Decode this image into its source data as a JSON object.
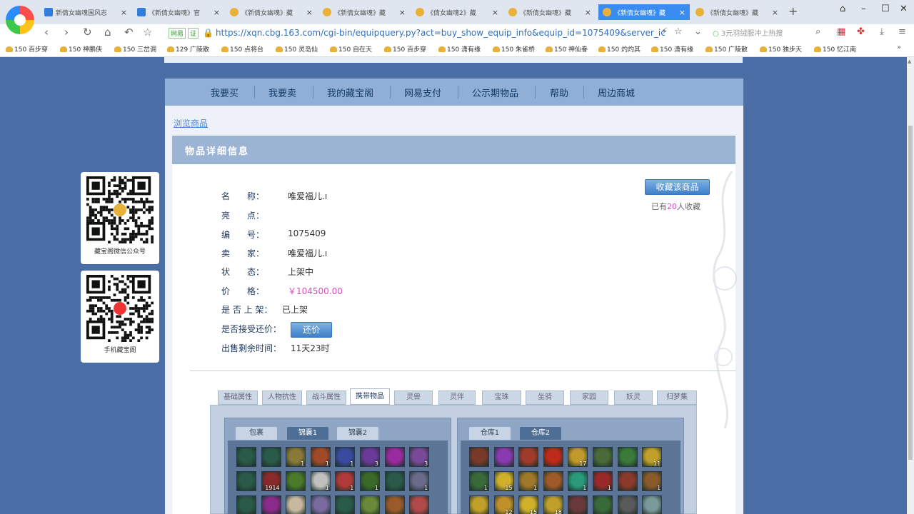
{
  "browser": {
    "tabs": [
      {
        "title": "新倩女幽魂国风志",
        "active": false
      },
      {
        "title": "《新倩女幽魂》官",
        "active": false
      },
      {
        "title": "《新倩女幽魂》藏",
        "active": false
      },
      {
        "title": "《新倩女幽魂》藏",
        "active": false
      },
      {
        "title": "《倩女幽魂2》藏",
        "active": false
      },
      {
        "title": "《新倩女幽魂》藏",
        "active": false
      },
      {
        "title": "《新倩女幽魂》藏",
        "active": true
      },
      {
        "title": "《新倩女幽魂》藏",
        "active": false
      }
    ],
    "tab_close": "×",
    "new_tab": "+",
    "url_badge": "网易",
    "url_badge2": "证",
    "url": "https://xqn.cbg.163.com/cgi-bin/equipquery.py?act=buy_show_equip_info&equip_id=1075409&server_ic",
    "search_placeholder": "3元羽绒服冲上热搜",
    "bookmarks": [
      "150 百步穿",
      "150 神鹏侠",
      "150 三岔调",
      "129 广陵散",
      "150 点将台",
      "150 灵岛仙",
      "150 自在天",
      "150 百步穿",
      "150 潇有缘",
      "150 朱雀桥",
      "150 神仙眷",
      "150 灼灼其",
      "150 潇有缘",
      "150 广陵散",
      "150 独步天",
      "150 忆江南"
    ],
    "bookmarks_more": "»"
  },
  "site_nav": [
    "我要买",
    "我要卖",
    "我的藏宝阁",
    "网易支付",
    "公示期物品",
    "帮助",
    "周边商城"
  ],
  "breadcrumb": "浏览商品",
  "detail_title": "物品详细信息",
  "favorite_button": "收藏该商品",
  "favorite_count_prefix": "已有",
  "favorite_count": "20",
  "favorite_count_suffix": "人收藏",
  "fields": {
    "name_label": "名　　称：",
    "name": "唯爱福儿.ı",
    "highlight_label": "亮　　点：",
    "id_label": "编　　号：",
    "id": "1075409",
    "seller_label": "卖　　家：",
    "seller": "唯爱福儿.ı",
    "status_label": "状　　态：",
    "status": "上架中",
    "price_label": "价　　格：",
    "price": "￥104500.00",
    "listed_label": "是 否 上 架：",
    "listed": "已上架",
    "counter_label": "是否接受还价：",
    "counter_button": "还价",
    "remaining_label": "出售剩余时间：",
    "remaining": "11天23时"
  },
  "info_tabs": [
    "基础属性",
    "人物抗性",
    "战斗属性",
    "携带物品",
    "灵兽",
    "灵伴",
    "宝珠",
    "坐骑",
    "家园",
    "妖灵",
    "归梦集"
  ],
  "active_info_tab": "携带物品",
  "left_pack": {
    "tabs": [
      "包裹",
      "锦囊1",
      "锦囊2"
    ],
    "active": "锦囊1",
    "rows": [
      [
        {
          "c": "#2a5a4a"
        },
        {
          "c": "#2a5a4a"
        },
        {
          "c": "#8a7a3a",
          "n": "1"
        },
        {
          "c": "#a04a2a",
          "n": "1"
        },
        {
          "c": "#3a4aa0",
          "n": "1"
        },
        {
          "c": "#6a3a9a",
          "n": "3"
        },
        {
          "c": "#9a2aa0"
        },
        {
          "c": "#7a4a9a",
          "n": "3"
        }
      ],
      [
        {
          "c": "#2a5a4a"
        },
        {
          "c": "#8a2a2a",
          "n": "1914"
        },
        {
          "c": "#4a7a2a"
        },
        {
          "c": "#c0c0c0",
          "n": "1"
        },
        {
          "c": "#b03a3a",
          "n": "1"
        },
        {
          "c": "#3a6a2a",
          "n": "1"
        },
        {
          "c": "#2a5a4a"
        },
        {
          "c": "#6a6a8a",
          "n": "1"
        }
      ],
      [
        {
          "c": "#2a5a4a"
        },
        {
          "c": "#8a2a8a"
        },
        {
          "c": "#c8b8a0"
        },
        {
          "c": "#7a6aa0"
        },
        {
          "c": "#2a5a4a"
        },
        {
          "c": "#6a8a3a"
        },
        {
          "c": "#9a5a2a"
        },
        {
          "c": "#b04a4a"
        }
      ]
    ]
  },
  "right_pack": {
    "tabs": [
      "仓库1",
      "仓库2"
    ],
    "active": "仓库2",
    "rows": [
      [
        {
          "c": "#7a3a2a"
        },
        {
          "c": "#8a3ab0"
        },
        {
          "c": "#a03a2a"
        },
        {
          "c": "#c02a1a"
        },
        {
          "c": "#c09a2a",
          "n": "17"
        },
        {
          "c": "#4a6a3a"
        },
        {
          "c": "#3a7a3a"
        },
        {
          "c": "#c0a02a",
          "n": "11"
        }
      ],
      [
        {
          "c": "#3a6a3a",
          "n": "1"
        },
        {
          "c": "#d0b02a",
          "n": "15"
        },
        {
          "c": "#a0782a",
          "n": "1"
        },
        {
          "c": "#a05a2a"
        },
        {
          "c": "#2a9a7a",
          "n": "1"
        },
        {
          "c": "#9a2a2a",
          "n": "1"
        },
        {
          "c": "#8a3a2a"
        },
        {
          "c": "#8a5a2a",
          "n": "1"
        }
      ],
      [
        {
          "c": "#c0a02a"
        },
        {
          "c": "#c0902a",
          "n": "12"
        },
        {
          "c": "#d0b02a",
          "n": "15"
        },
        {
          "c": "#c0a02a",
          "n": "18"
        },
        {
          "c": "#6a3a3a"
        },
        {
          "c": "#3a6a3a"
        },
        {
          "c": "#5a5a5a"
        },
        {
          "c": "#7a9a9a"
        }
      ]
    ]
  },
  "qr_wechat": "藏宝阁微信公众号",
  "qr_mobile": "手机藏宝阁"
}
